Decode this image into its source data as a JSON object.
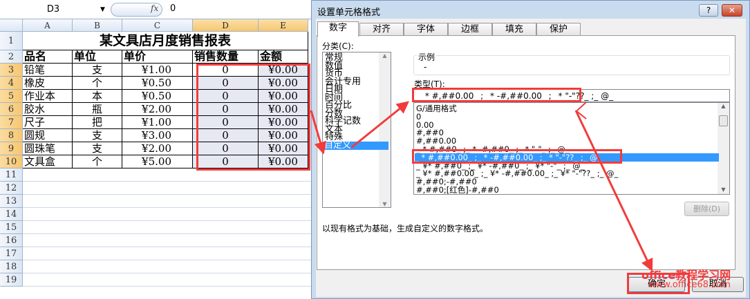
{
  "formula_bar": {
    "name_box": "D3",
    "fx_label": "fx",
    "value": "0"
  },
  "sheet": {
    "columns": [
      "A",
      "B",
      "C",
      "D",
      "E"
    ],
    "rows": [
      "1",
      "2",
      "3",
      "4",
      "5",
      "6",
      "7",
      "8",
      "9",
      "10",
      "11",
      "12",
      "13",
      "14",
      "15",
      "16",
      "17",
      "18",
      "19"
    ],
    "title": "某文具店月度销售报表",
    "headers": [
      "品名",
      "单位",
      "单价",
      "销售数量",
      "金额"
    ],
    "data": [
      [
        "铅笔",
        "支",
        "¥1.00",
        "0",
        "¥0.00"
      ],
      [
        "橡皮",
        "个",
        "¥0.50",
        "0",
        "¥0.00"
      ],
      [
        "作业本",
        "本",
        "¥0.50",
        "0",
        "¥0.00"
      ],
      [
        "胶水",
        "瓶",
        "¥2.00",
        "0",
        "¥0.00"
      ],
      [
        "尺子",
        "把",
        "¥1.00",
        "0",
        "¥0.00"
      ],
      [
        "圆规",
        "支",
        "¥3.00",
        "0",
        "¥0.00"
      ],
      [
        "圆珠笔",
        "支",
        "¥2.00",
        "0",
        "¥0.00"
      ],
      [
        "文具盒",
        "个",
        "¥5.00",
        "0",
        "¥0.00"
      ]
    ]
  },
  "dialog": {
    "title": "设置单元格格式",
    "help": "?",
    "close": "✕",
    "tabs": [
      "数字",
      "对齐",
      "字体",
      "边框",
      "填充",
      "保护"
    ],
    "category_label": "分类(C):",
    "categories": [
      "常规",
      "数值",
      "货币",
      "会计专用",
      "日期",
      "时间",
      "百分比",
      "分数",
      "科学记数",
      "文本",
      "特殊",
      "自定义"
    ],
    "sample_label": "示例",
    "sample_value": "-",
    "type_label": "类型(T):",
    "type_value": "_ * #,##0.00_ ;_ * -#,##0.00_ ;_ * \"-\"??_ ;_ @_",
    "formats": [
      "G/通用格式",
      "0",
      "0.00",
      "#,##0",
      "#,##0.00",
      "_ * #,##0_ ;_ * -#,##0_ ;_ * \"-\"_ ;_ @_",
      "_ * #,##0.00_ ;_ * -#,##0.00_ ;_ * \"-\"??_ ;_ @_",
      "_ ¥* #,##0_ ;_ ¥* -#,##0_ ;_ ¥* \"-\"_ ;_ @_",
      "_ ¥* #,##0.00_ ;_ ¥* -#,##0.00_ ;_ ¥* \"-\"??_ ;_ @_",
      "#,##0;-#,##0",
      "#,##0;[红色]-#,##0"
    ],
    "delete_button": "删除(D)",
    "description": "以现有格式为基础，生成自定义的数字格式。",
    "ok_button": "确定",
    "cancel_button": "取消"
  },
  "watermark": {
    "line1": "office教程学习网",
    "line2": "www.office68.com"
  },
  "colors": {
    "accent": "#3399ff",
    "annotation": "#f23b3b"
  }
}
